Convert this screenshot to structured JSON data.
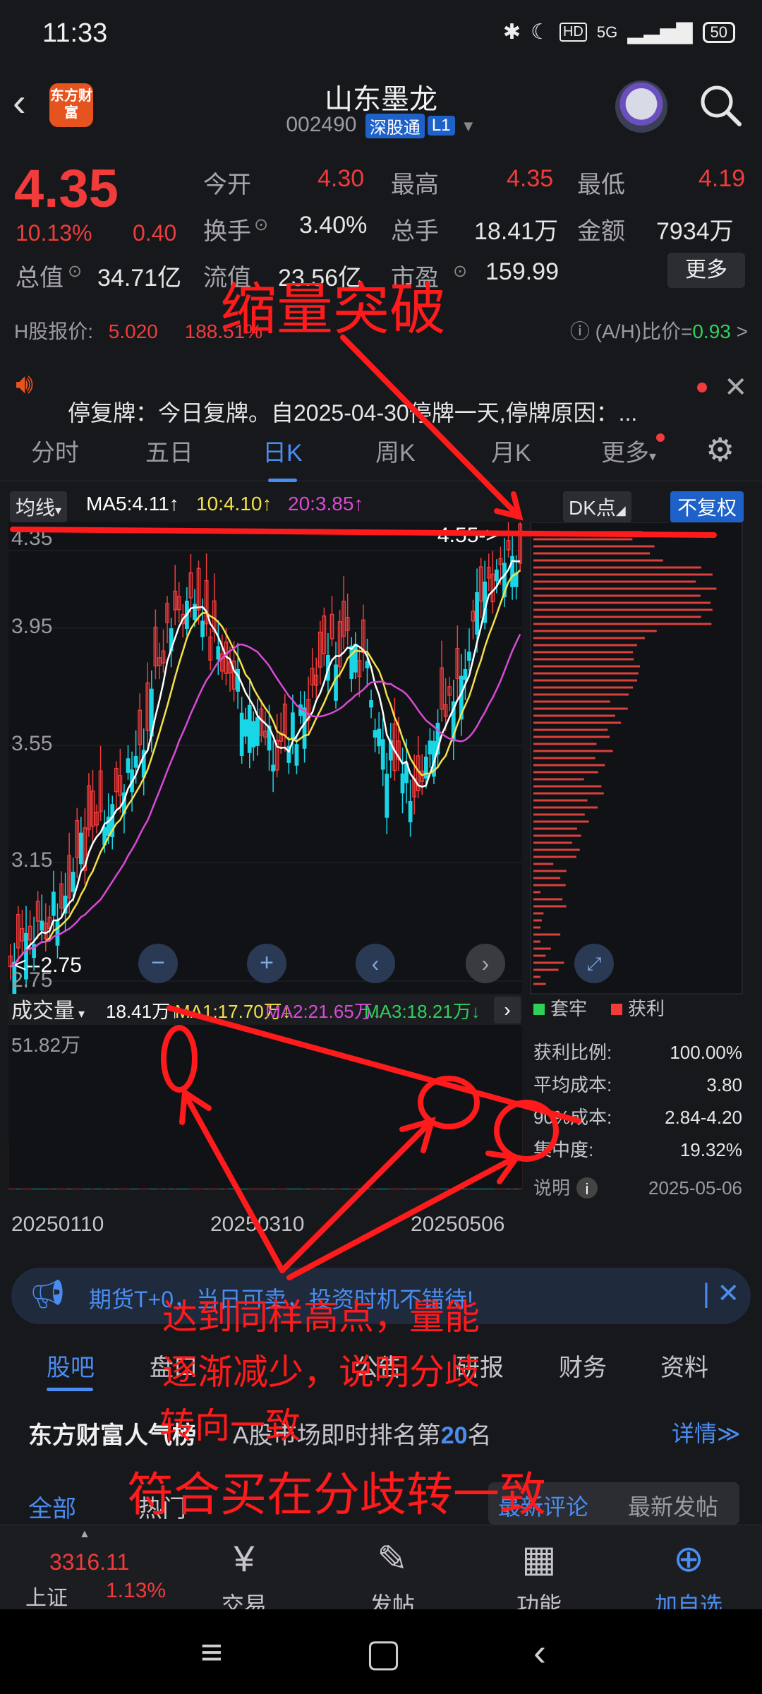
{
  "status_bar": {
    "time": "11:33",
    "network": "5G",
    "battery": "50"
  },
  "header": {
    "app_logo_text": "东方财富",
    "title": "山东墨龙",
    "code": "002490",
    "tag": "深股通",
    "level": "L1"
  },
  "quote": {
    "price": "4.35",
    "change_pct": "10.13%",
    "change": "0.40",
    "open_label": "今开",
    "open": "4.30",
    "high_label": "最高",
    "high": "4.35",
    "low_label": "最低",
    "low": "4.19",
    "turnover_label": "换手",
    "turnover": "3.40%",
    "volume_label": "总手",
    "volume": "18.41万",
    "amount_label": "金额",
    "amount": "7934万",
    "mktcap_label": "总值",
    "mktcap": "34.71亿",
    "float_label": "流值",
    "float": "23.56亿",
    "pe_label": "市盈",
    "pe": "159.99",
    "more": "更多",
    "hk_label": "H股报价:",
    "hk_price": "5.020",
    "hk_pct": "188.51%",
    "ah_label": "(A/H)比价=",
    "ah_value": "0.93",
    "ah_arrow": ">"
  },
  "notice": {
    "text": "停复牌：今日复牌。自2025-04-30停牌一天,停牌原因：..."
  },
  "period_tabs": [
    "分时",
    "五日",
    "日K",
    "周K",
    "月K",
    "更多"
  ],
  "chart_header": {
    "ma_select": "均线",
    "ma5": "MA5:4.11",
    "ma10": "10:4.10",
    "ma20": "20:3.85",
    "dk": "DK点",
    "fq": "不复权"
  },
  "chart_labels": {
    "p1": "4.35",
    "p2": "3.95",
    "p3": "3.55",
    "p4": "3.15",
    "p5": "2.75",
    "high_marker": "4.55->",
    "low_marker": "<--2.75"
  },
  "volume_header": {
    "select": "成交量",
    "vol": "18.41万",
    "ma1": "MA1:17.70万",
    "ma2": "MA2:21.65万",
    "ma3": "MA3:18.21万",
    "max": "51.82万"
  },
  "dates": [
    "20250110",
    "20250310",
    "20250506"
  ],
  "chip": {
    "legend_trapped": "套牢",
    "legend_profit": "获利",
    "rows": [
      {
        "label": "获利比例:",
        "value": "100.00%"
      },
      {
        "label": "平均成本:",
        "value": "3.80"
      },
      {
        "label": "90%成本:",
        "value": "2.84-4.20"
      },
      {
        "label": "集中度:",
        "value": "19.32%"
      }
    ],
    "note_label": "说明",
    "date": "2025-05-06"
  },
  "ad_banner": {
    "text": "期货T+0，当日可卖，投资时机不错待!"
  },
  "bottom_tabs": [
    "股吧",
    "盘口",
    "公告",
    "研报",
    "财务",
    "资料"
  ],
  "ranking": {
    "brand": "东方财富人气榜",
    "text": "A股市场即时排名第",
    "rank": "20",
    "suffix": "名",
    "detail": "详情"
  },
  "filter": {
    "all": "全部",
    "hot": "热门",
    "latest_comment": "最新评论",
    "latest_post": "最新发帖"
  },
  "nav": {
    "index_value": "3316.11",
    "index_name": "上证",
    "index_pct": "1.13%",
    "trade": "交易",
    "post": "发帖",
    "functions": "功能",
    "add": "加自选"
  },
  "annotations": {
    "breakout": "缩量突破",
    "line1": "达到同样高点，量能",
    "line2": "逐渐减少，说明分歧",
    "line3": "转向一致",
    "conclusion": "符合买在分歧转一致"
  }
}
